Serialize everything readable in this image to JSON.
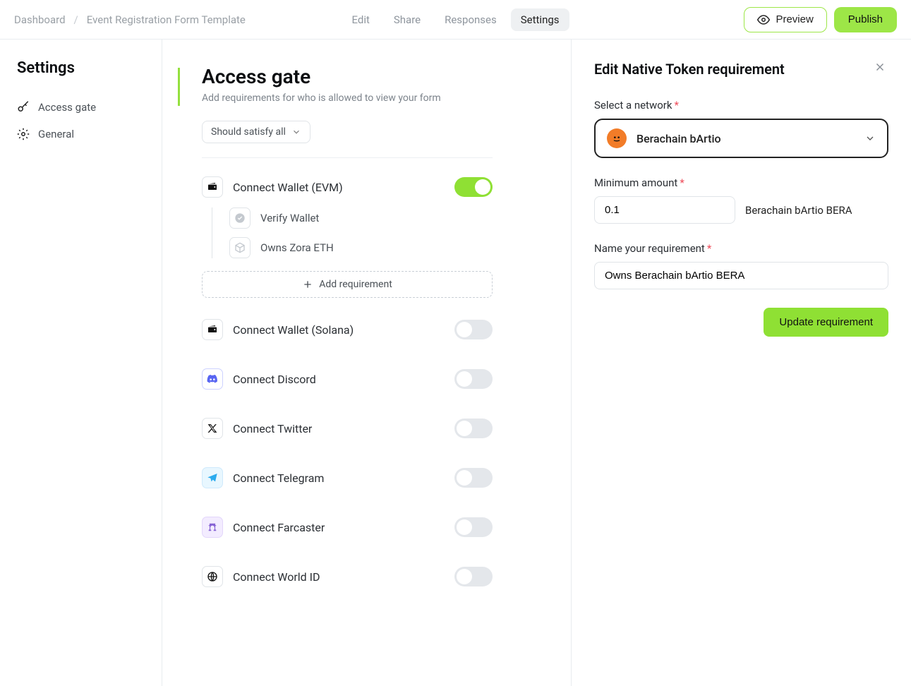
{
  "header": {
    "breadcrumb_root": "Dashboard",
    "breadcrumb_current": "Event Registration Form Template",
    "tabs": [
      "Edit",
      "Share",
      "Responses",
      "Settings"
    ],
    "preview_label": "Preview",
    "publish_label": "Publish"
  },
  "sidebar": {
    "title": "Settings",
    "items": [
      {
        "label": "Access gate"
      },
      {
        "label": "General"
      }
    ]
  },
  "main": {
    "title": "Access gate",
    "subtitle": "Add requirements for who is allowed to view your form",
    "satisfy_label": "Should satisfy all",
    "evm": {
      "label": "Connect Wallet (EVM)",
      "subs": [
        {
          "label": "Verify Wallet"
        },
        {
          "label": "Owns Zora ETH"
        }
      ],
      "add_label": "Add requirement"
    },
    "connectors": [
      {
        "label": "Connect Wallet (Solana)"
      },
      {
        "label": "Connect Discord"
      },
      {
        "label": "Connect Twitter"
      },
      {
        "label": "Connect Telegram"
      },
      {
        "label": "Connect Farcaster"
      },
      {
        "label": "Connect World ID"
      }
    ]
  },
  "drawer": {
    "title": "Edit Native Token requirement",
    "network_label": "Select a network",
    "network_value": "Berachain bArtio",
    "min_label": "Minimum amount",
    "min_value": "0.1",
    "min_suffix": "Berachain bArtio BERA",
    "name_label": "Name your requirement",
    "name_value": "Owns Berachain bArtio BERA",
    "update_label": "Update requirement"
  }
}
